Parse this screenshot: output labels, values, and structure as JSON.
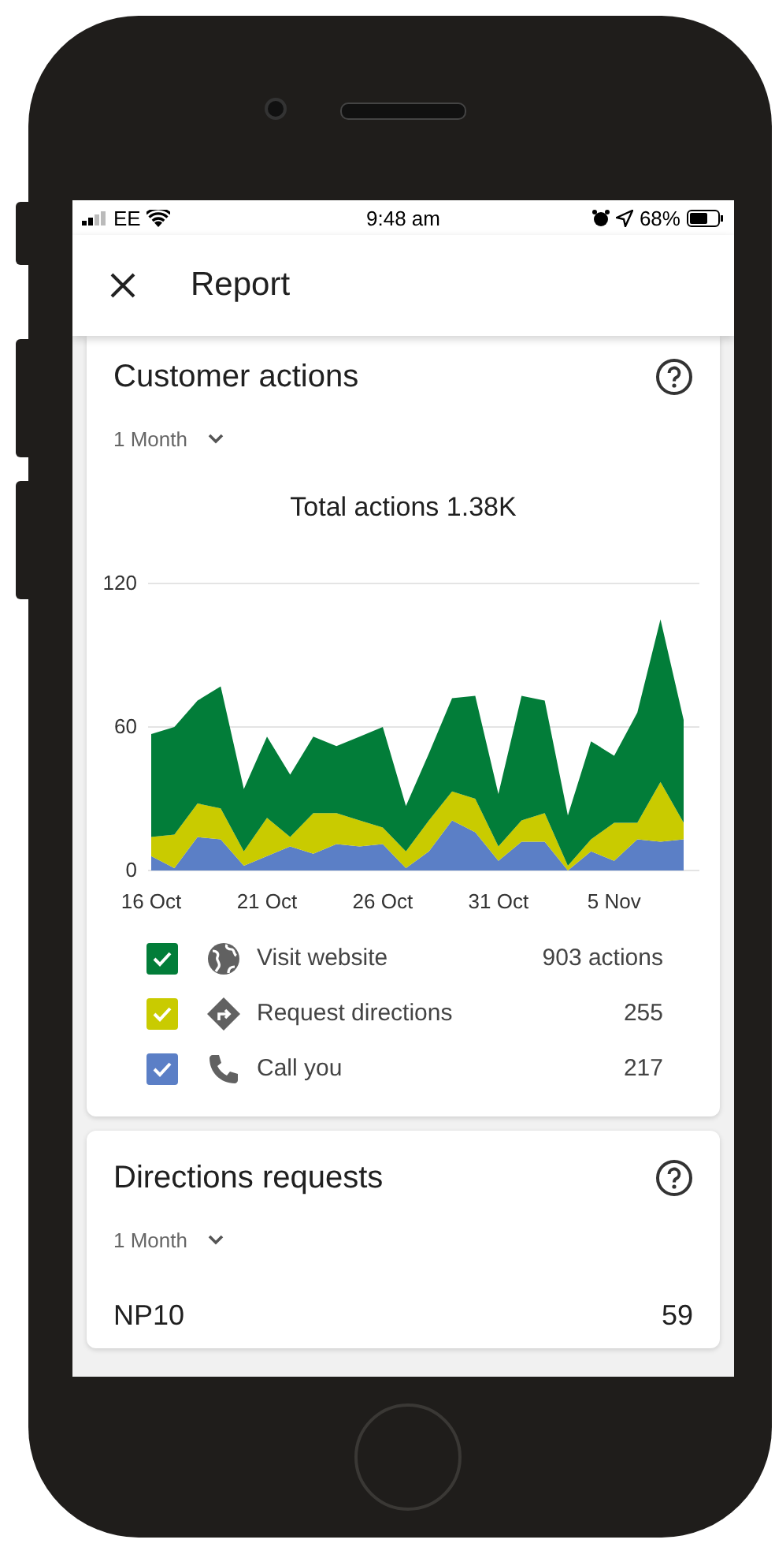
{
  "status_bar": {
    "carrier": "EE",
    "time": "9:48 am",
    "battery": "68%"
  },
  "header": {
    "title": "Report"
  },
  "cards": [
    {
      "title": "Customer actions",
      "period": "1 Month",
      "total": "Total actions 1.38K",
      "chart_data": {
        "type": "area",
        "stacked": true,
        "categories": [
          "16 Oct",
          null,
          null,
          null,
          null,
          "21 Oct",
          null,
          null,
          null,
          null,
          "26 Oct",
          null,
          null,
          null,
          null,
          "31 Oct",
          null,
          null,
          null,
          null,
          "5 Nov",
          null,
          null,
          null
        ],
        "series": [
          {
            "name": "Visit website",
            "color": "#027d39",
            "values": [
              43,
              45,
              43,
              51,
              26,
              34,
              26,
              32,
              28,
              35,
              42,
              19,
              28,
              39,
              43,
              22,
              52,
              47,
              21,
              41,
              28,
              46,
              68,
              43
            ]
          },
          {
            "name": "Request directions",
            "color": "#c9cb00",
            "values": [
              8,
              14,
              14,
              13,
              6,
              16,
              4,
              17,
              13,
              11,
              7,
              7,
              13,
              12,
              14,
              6,
              9,
              12,
              2,
              5,
              16,
              7,
              25,
              7
            ]
          },
          {
            "name": "Call you",
            "color": "#5b7fc6",
            "values": [
              6,
              1,
              14,
              13,
              2,
              6,
              10,
              7,
              11,
              10,
              11,
              1,
              8,
              21,
              16,
              4,
              12,
              12,
              0,
              8,
              4,
              13,
              12,
              13
            ]
          }
        ],
        "ylim": [
          0,
          120
        ],
        "yticks": [
          0,
          60,
          120
        ]
      },
      "legend": [
        {
          "value": "903 actions",
          "checked": true
        },
        {
          "value": "255",
          "checked": true
        },
        {
          "value": "217",
          "checked": true
        }
      ]
    },
    {
      "title": "Directions requests",
      "period": "1 Month",
      "rows": [
        {
          "label": "NP10",
          "value": "59"
        }
      ]
    }
  ]
}
